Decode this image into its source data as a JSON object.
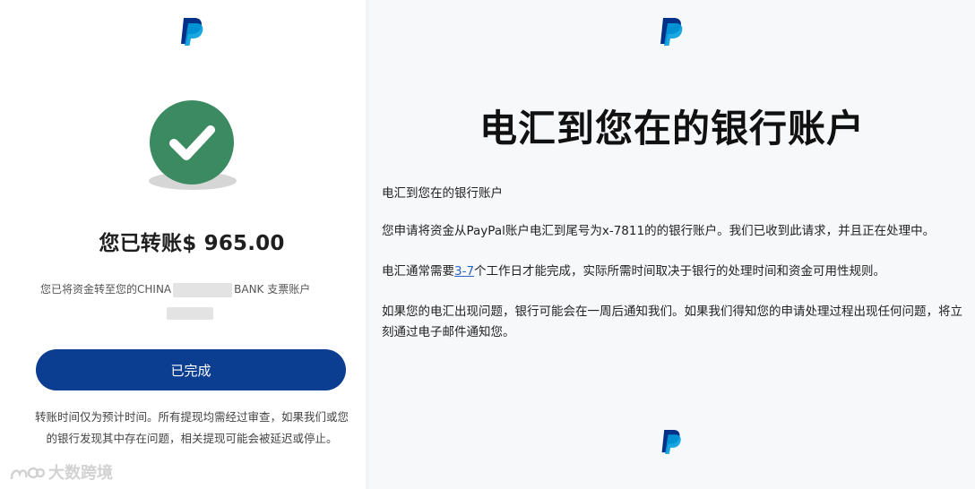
{
  "left": {
    "logo": "paypal-logo",
    "status_icon": "check-icon",
    "amount_title": "您已转账$ 965.00",
    "desc_prefix": "您已将资金转至您的CHINA",
    "desc_suffix": "BANK 支票账户",
    "done_button": "已完成",
    "note": "转账时间仅为预计时间。所有提现均需经过审查，如果我们或您的银行发现其中存在问题，相关提现可能会被延迟或停止。",
    "watermark": "大数跨境",
    "colors": {
      "success": "#3b8a62",
      "button": "#0b3d91"
    }
  },
  "right": {
    "logo": "paypal-logo",
    "heading": "电汇到您在的银行账户",
    "subheading": "电汇到您在的银行账户",
    "p1": "您申请将资金从PayPal账户电汇到尾号为x-7811的的银行账户。我们已收到此请求，并且正在处理中。",
    "p2_before": "电汇通常需要",
    "p2_link": "3-7",
    "p2_after": "个工作日才能完成，实际所需时间取决于银行的处理时间和资金可用性规则。",
    "p3": "如果您的电汇出现问题，银行可能会在一周后通知我们。如果我们得知您的申请处理过程出现任何问题，将立刻通过电子邮件通知您。",
    "colors": {
      "link": "#2a64c5"
    }
  }
}
